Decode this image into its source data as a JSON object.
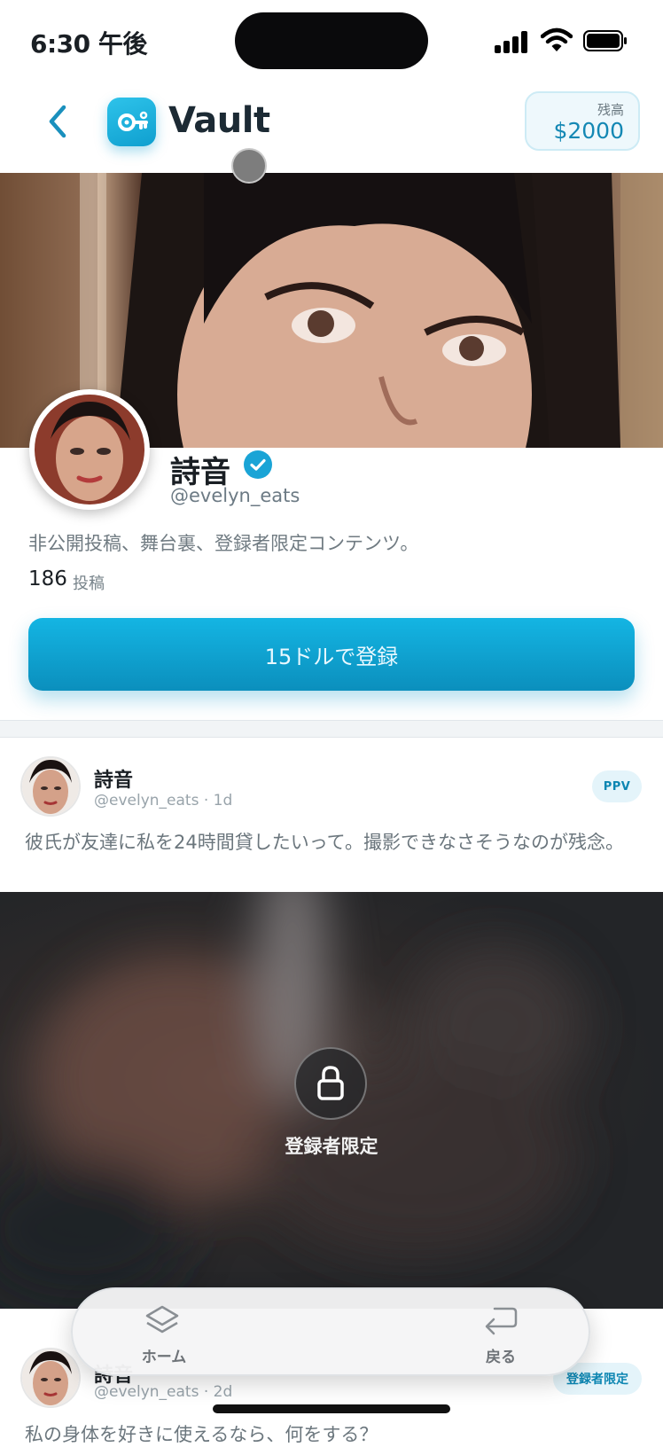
{
  "status_bar": {
    "time": "6:30 午後"
  },
  "header": {
    "back_icon": "chevron-left-icon",
    "logo_icon": "key-icon",
    "app_title": "Vault",
    "balance_label": "残高",
    "balance_value": "$2000"
  },
  "profile": {
    "name": "詩音",
    "verified": true,
    "handle": "@evelyn_eats",
    "bio": "非公開投稿、舞台裏、登録者限定コンテンツ。",
    "post_count": "186",
    "post_count_label": "投稿",
    "subscribe_label": "15ドルで登録"
  },
  "posts": [
    {
      "name": "詩音",
      "meta": "@evelyn_eats · 1d",
      "badge": "PPV",
      "text": "彼氏が友達に私を24時間貸したいって。撮影できなさそうなのが残念。",
      "locked_label": "登録者限定"
    },
    {
      "name": "詩音",
      "meta": "@evelyn_eats · 2d",
      "badge": "登録者限定",
      "text": "私の身体を好きに使えるなら、何をする？"
    }
  ],
  "bottom_nav": {
    "home_label": "ホーム",
    "back_label": "戻る"
  },
  "colors": {
    "accent": "#0f9fcf",
    "accent_light": "#e4f4fa",
    "text_primary": "#1a1f24",
    "text_muted": "#6b767d"
  }
}
